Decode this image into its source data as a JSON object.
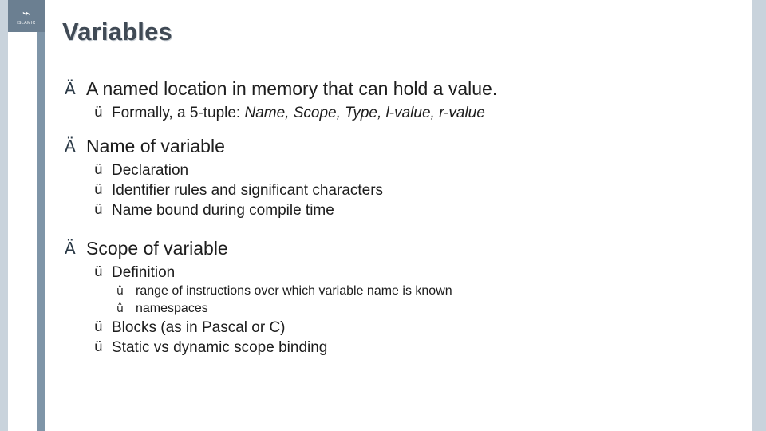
{
  "logo": {
    "glyph": "⌁",
    "caption": "ISLAMIC"
  },
  "slide": {
    "title": "Variables",
    "bullets": {
      "b1": "A named location in memory that can hold a value.",
      "b1_1_prefix": "Formally, a 5-tuple: ",
      "b1_1_italic": "Name, Scope, Type, l-value, r-value",
      "b2": "Name of variable",
      "b2_1": "Declaration",
      "b2_2": "Identifier rules and significant characters",
      "b2_3": "Name bound during compile time",
      "b3": "Scope of variable",
      "b3_1": "Definition",
      "b3_1_1": "range of instructions over which variable name is known",
      "b3_1_2": "namespaces",
      "b3_2": "Blocks (as in Pascal or C)",
      "b3_3": "Static vs dynamic scope binding"
    },
    "markers": {
      "level1": "Ä",
      "level2": "ü",
      "level3": "û"
    }
  }
}
